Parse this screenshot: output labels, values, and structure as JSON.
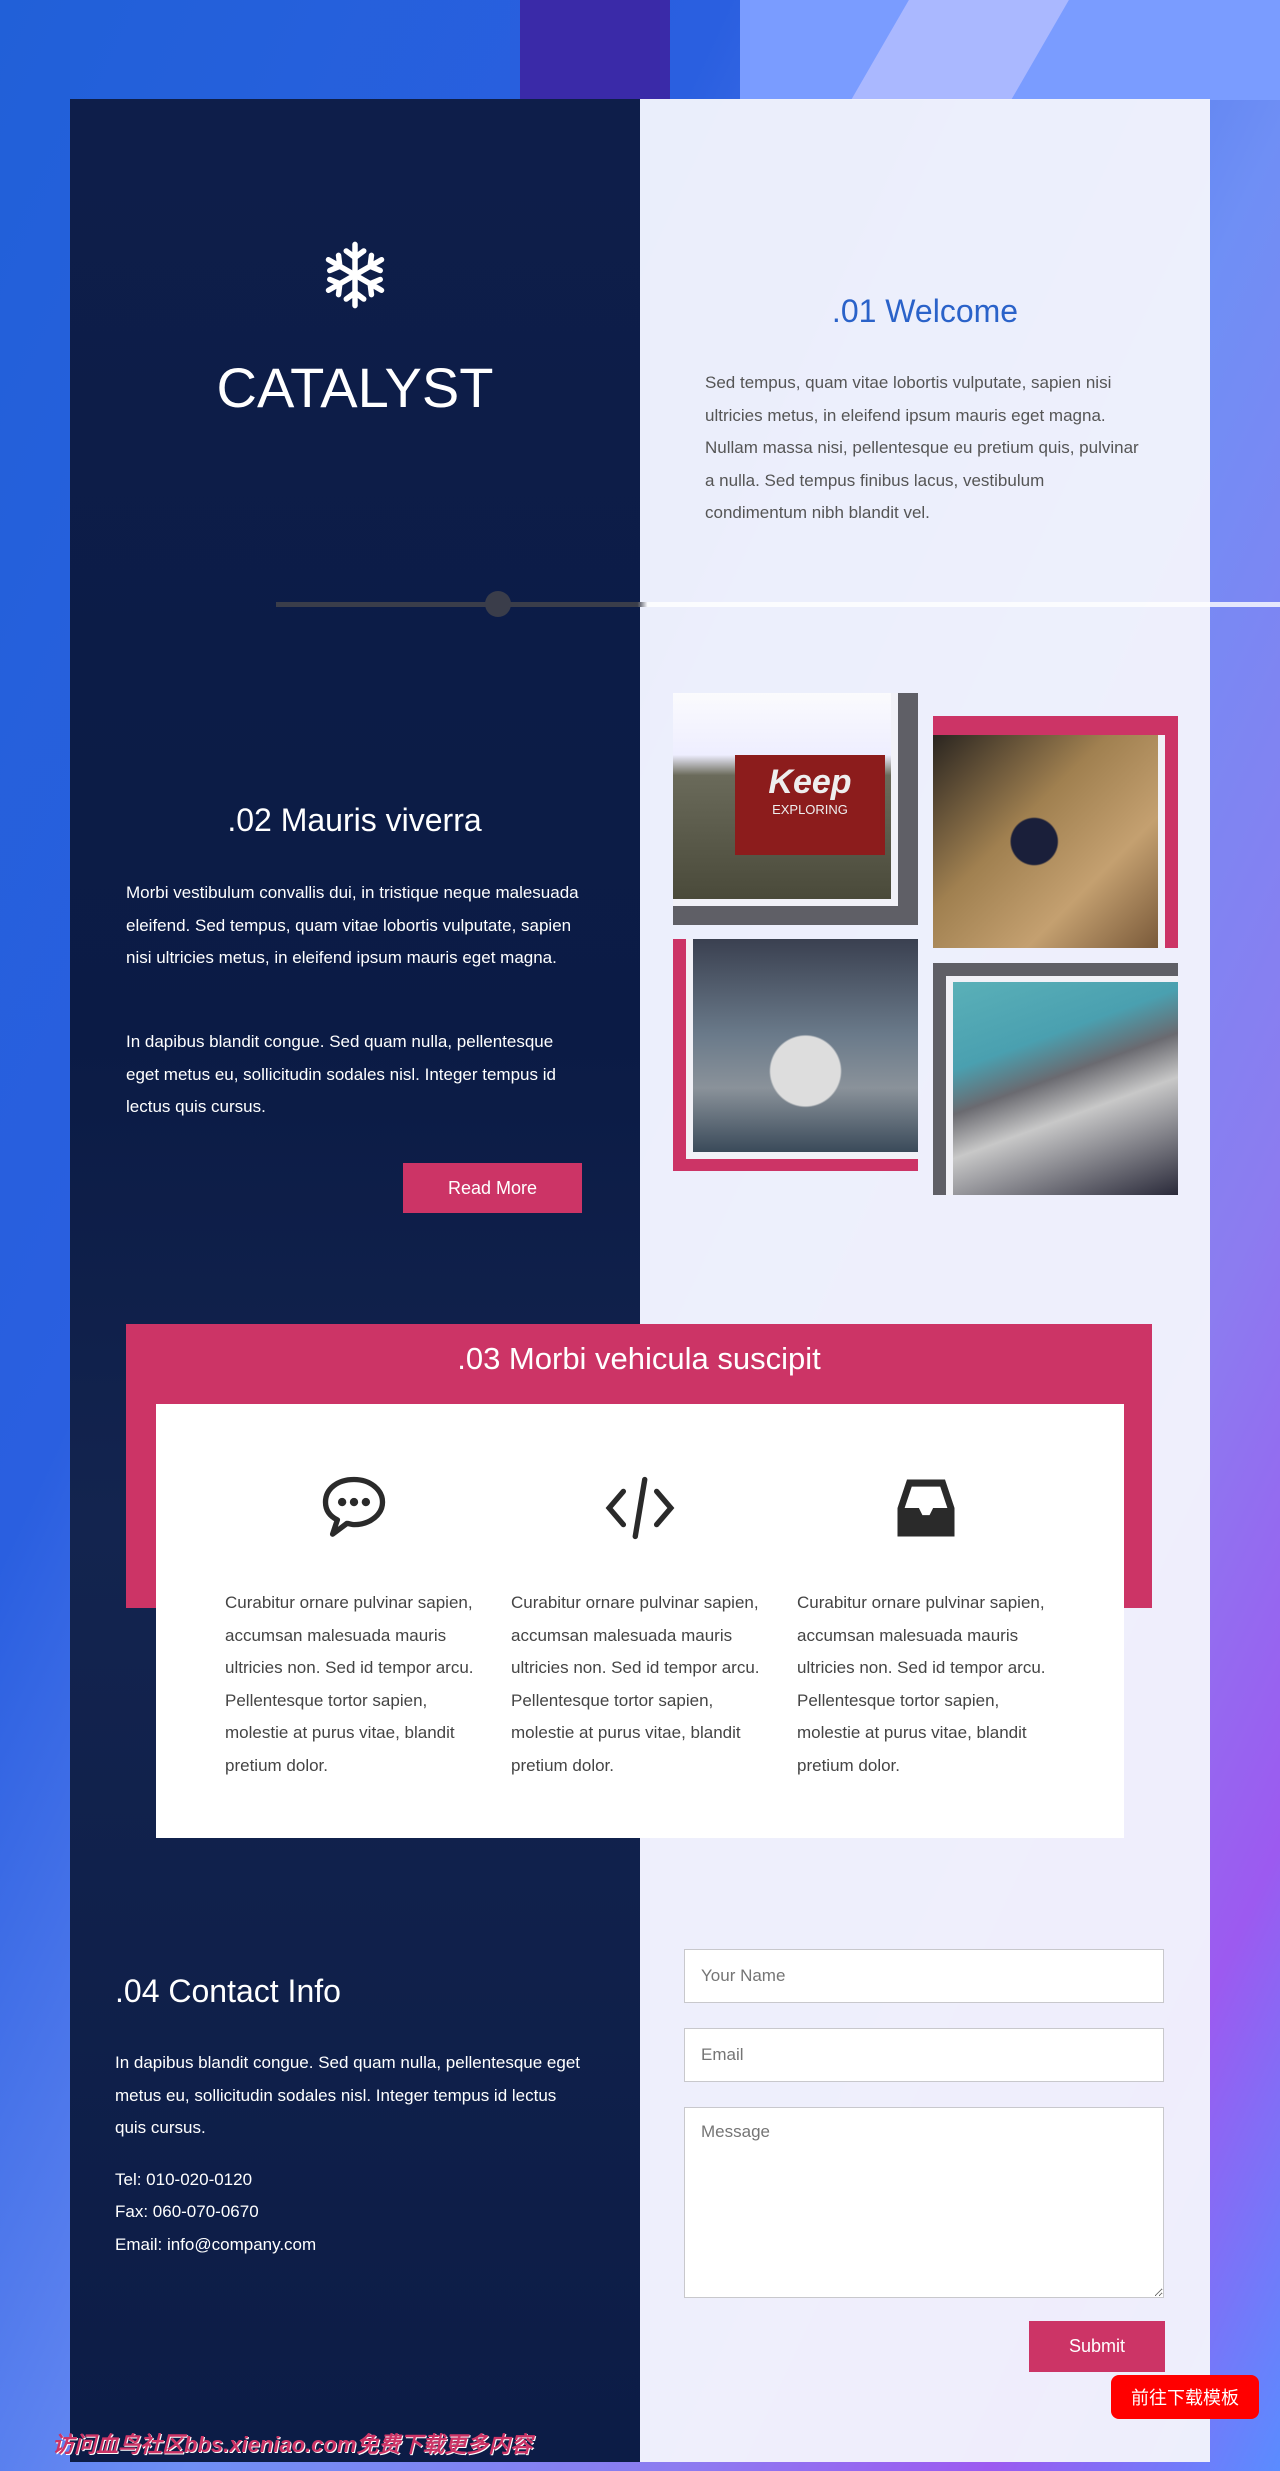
{
  "brand": {
    "title": "CATALYST",
    "icon": "snowflake-icon"
  },
  "welcome": {
    "heading": ".01 Welcome",
    "text": "Sed tempus, quam vitae lobortis vulputate, sapien nisi ultricies metus, in eleifend ipsum mauris eget magna. Nullam massa nisi, pellentesque eu pretium quis, pulvinar a nulla. Sed tempus finibus lacus, vestibulum condimentum nibh blandit vel."
  },
  "about": {
    "heading": ".02 Mauris viverra",
    "p1": "Morbi vestibulum convallis dui, in tristique neque malesuada eleifend. Sed tempus, quam vitae lobortis vulputate, sapien nisi ultricies metus, in eleifend ipsum mauris eget magna.",
    "p2": "In dapibus blandit congue. Sed quam nulla, pellentesque eget metus eu, sollicitudin sodales nisl. Integer tempus id lectus quis cursus.",
    "button": "Read More"
  },
  "gallery": {
    "images": [
      "Keep Exploring flag photo",
      "Puffin photo",
      "Frozen bubble photo",
      "Aerial city photo"
    ],
    "flag_text": [
      "Keep",
      "EXPLORING"
    ]
  },
  "features": {
    "heading": ".03 Morbi vehicula suscipit",
    "columns": [
      {
        "icon": "chat-bubble-icon",
        "text": "Curabitur ornare pulvinar sapien, accumsan malesuada mauris ultricies non. Sed id tempor arcu. Pellentesque tortor sapien, molestie at purus vitae, blandit pretium dolor."
      },
      {
        "icon": "code-icon",
        "text": "Curabitur ornare pulvinar sapien, accumsan malesuada mauris ultricies non. Sed id tempor arcu. Pellentesque tortor sapien, molestie at purus vitae, blandit pretium dolor."
      },
      {
        "icon": "inbox-icon",
        "text": "Curabitur ornare pulvinar sapien, accumsan malesuada mauris ultricies non. Sed id tempor arcu. Pellentesque tortor sapien, molestie at purus vitae, blandit pretium dolor."
      }
    ]
  },
  "contact": {
    "heading": ".04 Contact Info",
    "text": "In dapibus blandit congue. Sed quam nulla, pellentesque eget metus eu, sollicitudin sodales nisl. Integer tempus id lectus quis cursus.",
    "tel": "Tel: 010-020-0120",
    "fax": "Fax: 060-070-0670",
    "email": "Email: info@company.com"
  },
  "form": {
    "name_placeholder": "Your Name",
    "email_placeholder": "Email",
    "message_placeholder": "Message",
    "submit": "Submit"
  },
  "download_button": "前往下载模板",
  "watermark": "访问血鸟社区bbs.xieniao.com免费下载更多内容",
  "colors": {
    "accent": "#cc3466",
    "heading_blue": "#2a62c9",
    "navy": "#0e1e4a",
    "gray_frame": "#5f5f66"
  }
}
